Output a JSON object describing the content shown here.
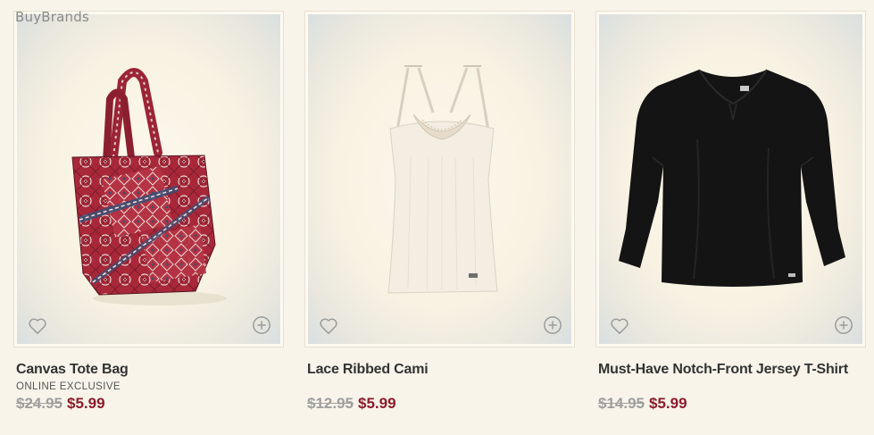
{
  "watermark": "BuyBrands",
  "products": [
    {
      "name": "Canvas Tote Bag",
      "badge": "ONLINE EXCLUSIVE",
      "old_price": "$24.95",
      "sale_price": "$5.99",
      "image": "canvas-tote-bag-image"
    },
    {
      "name": "Lace Ribbed Cami",
      "badge": "",
      "old_price": "$12.95",
      "sale_price": "$5.99",
      "image": "lace-ribbed-cami-image"
    },
    {
      "name": "Must-Have Notch-Front Jersey T-Shirt",
      "badge": "",
      "old_price": "$14.95",
      "sale_price": "$5.99",
      "image": "jersey-t-shirt-image"
    }
  ],
  "icons": {
    "favorite": "heart-icon",
    "add": "plus-circle-icon"
  },
  "colors": {
    "background": "#f8f4ea",
    "sale_price": "#8c1b2b",
    "old_price": "#9e9e9e",
    "product_name": "#333333"
  }
}
